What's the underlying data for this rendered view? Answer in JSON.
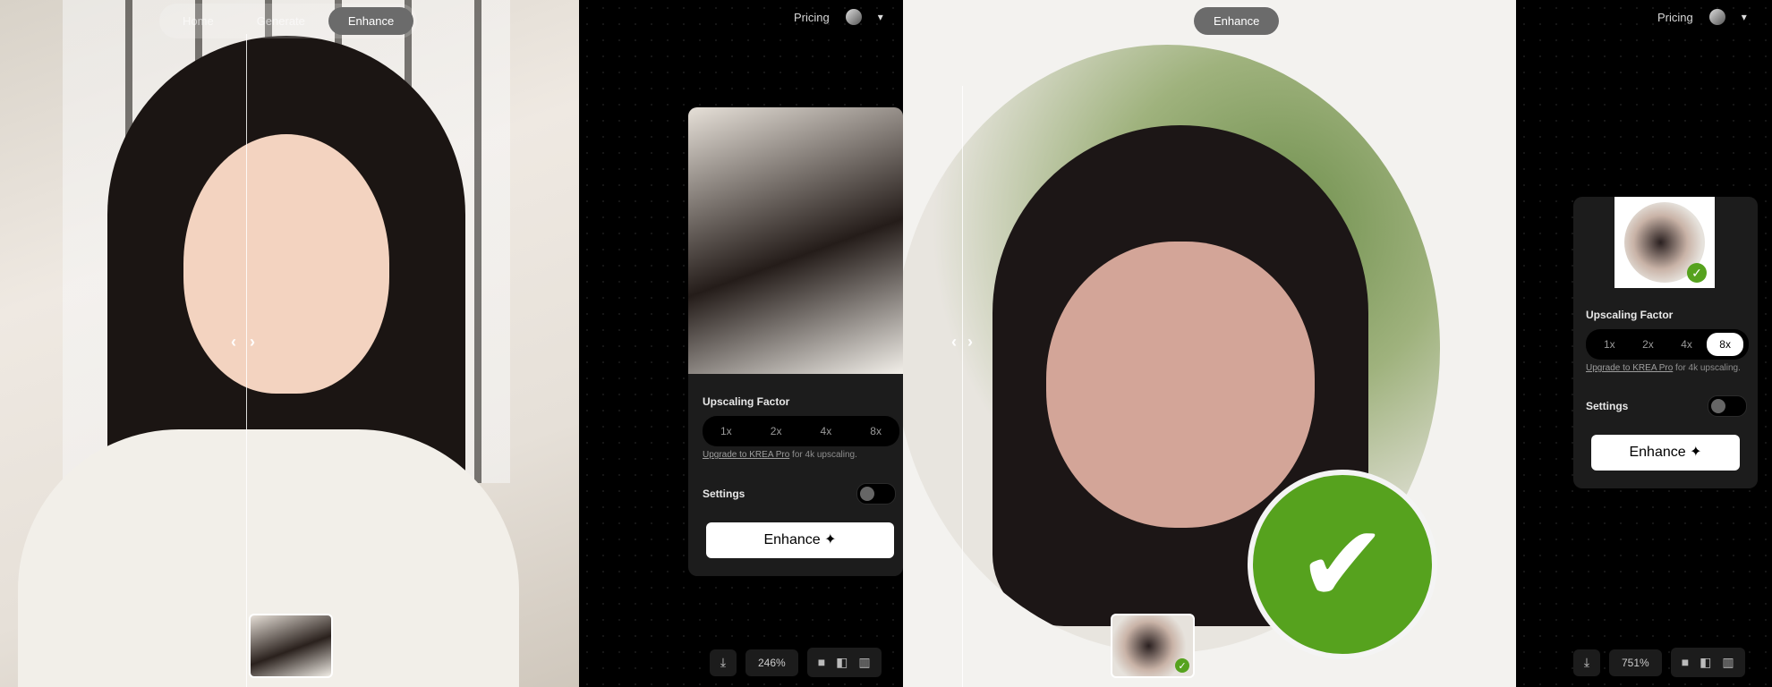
{
  "nav": {
    "tabs": [
      {
        "label": "Home"
      },
      {
        "label": "Generate"
      },
      {
        "label": "Enhance"
      }
    ],
    "pricing": "Pricing"
  },
  "left_panel": {
    "upscaling_label": "Upscaling Factor",
    "factors": [
      "1x",
      "2x",
      "4x",
      "8x"
    ],
    "upgrade_link": "Upgrade to KREA Pro",
    "upgrade_suffix": " for 4k upscaling.",
    "settings_label": "Settings",
    "enhance_button": "Enhance",
    "zoom": "246%"
  },
  "right_panel": {
    "upscaling_label": "Upscaling Factor",
    "factors": [
      "1x",
      "2x",
      "4x",
      "8x"
    ],
    "selected_factor": "8x",
    "upgrade_link": "Upgrade to KREA Pro",
    "upgrade_suffix": " for 4k upscaling.",
    "settings_label": "Settings",
    "enhance_button": "Enhance",
    "zoom": "751%"
  },
  "right_nav_tab": "Enhance",
  "colors": {
    "accent_green": "#56a21e",
    "card": "#1c1c1c",
    "pill_active": "#6b6b6b"
  },
  "icons": [
    "download-icon",
    "sparkle-icon",
    "chevron-down-icon",
    "check-icon",
    "single-view-icon",
    "split-view-icon",
    "side-by-side-icon"
  ]
}
